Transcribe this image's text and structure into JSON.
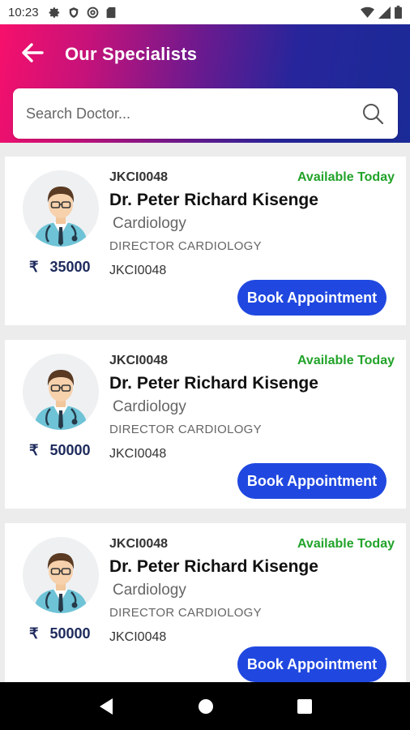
{
  "status_bar": {
    "time": "10:23",
    "left_icons": [
      "gear-icon",
      "shield-icon",
      "at-sign-icon",
      "sd-card-icon"
    ],
    "right_icons": [
      "wifi-icon",
      "signal-icon",
      "battery-icon"
    ]
  },
  "header": {
    "title": "Our Specialists",
    "back_icon": "arrow-left-icon"
  },
  "search": {
    "placeholder": "Search Doctor...",
    "value": ""
  },
  "doctors": [
    {
      "code": "JKCI0048",
      "availability": "Available Today",
      "name": "Dr. Peter Richard Kisenge",
      "specialty": "Cardiology",
      "designation": "DIRECTOR CARDIOLOGY",
      "code2": "JKCI0048",
      "currency": "₹",
      "fee": "35000",
      "button_label": "Book Appointment"
    },
    {
      "code": "JKCI0048",
      "availability": "Available Today",
      "name": "Dr. Peter Richard Kisenge",
      "specialty": "Cardiology",
      "designation": "DIRECTOR CARDIOLOGY",
      "code2": "JKCI0048",
      "currency": "₹",
      "fee": "50000",
      "button_label": "Book Appointment"
    },
    {
      "code": "JKCI0048",
      "availability": "Available Today",
      "name": "Dr. Peter Richard Kisenge",
      "specialty": "Cardiology",
      "designation": "DIRECTOR CARDIOLOGY",
      "code2": "JKCI0048",
      "currency": "₹",
      "fee": "50000",
      "button_label": "Book Appointment"
    }
  ],
  "nav_bar": {
    "icons": [
      "back-triangle-icon",
      "home-circle-icon",
      "recents-square-icon"
    ]
  },
  "colors": {
    "gradient_start": "#f7106b",
    "gradient_end": "#1a2a96",
    "button": "#2048e0",
    "available": "#22a32a",
    "price": "#1e2a5c"
  }
}
